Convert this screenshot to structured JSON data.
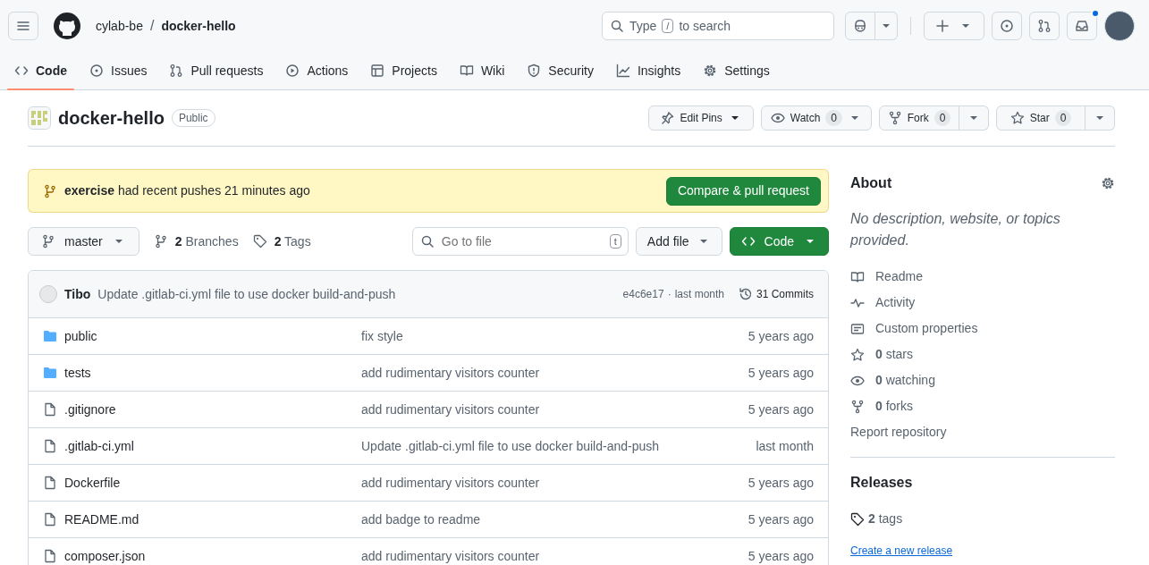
{
  "header": {
    "owner": "cylab-be",
    "separator": "/",
    "repo": "docker-hello",
    "search": {
      "prefix": "Type",
      "key": "/",
      "suffix": "to search"
    },
    "inbox_unread": true
  },
  "tabs": [
    {
      "label": "Code",
      "selected": true
    },
    {
      "label": "Issues",
      "selected": false
    },
    {
      "label": "Pull requests",
      "selected": false
    },
    {
      "label": "Actions",
      "selected": false
    },
    {
      "label": "Projects",
      "selected": false
    },
    {
      "label": "Wiki",
      "selected": false
    },
    {
      "label": "Security",
      "selected": false
    },
    {
      "label": "Insights",
      "selected": false
    },
    {
      "label": "Settings",
      "selected": false
    }
  ],
  "repo": {
    "name": "docker-hello",
    "visibility": "Public",
    "edit_pins": "Edit Pins",
    "watch": {
      "label": "Watch",
      "count": "0"
    },
    "fork": {
      "label": "Fork",
      "count": "0"
    },
    "star": {
      "label": "Star",
      "count": "0"
    }
  },
  "banner": {
    "text": "**exercise** had recent pushes 21 minutes ago",
    "button": "Compare & pull request"
  },
  "toolbar": {
    "branch": "master",
    "branches": "**2** Branches",
    "tags": "**2** Tags",
    "go_to_file": {
      "placeholder": "Go to file",
      "key": "t"
    },
    "add_file": "Add file",
    "code": "Code"
  },
  "commit": {
    "author": "Tibo",
    "message": "Update .gitlab-ci.yml file to use docker build-and-push",
    "sha": "e4c6e17",
    "dot": "·",
    "time": "last month",
    "commits": "31 Commits"
  },
  "files": [
    {
      "kind": "folder",
      "name": "public",
      "message": "fix style",
      "time": "5 years ago"
    },
    {
      "kind": "folder",
      "name": "tests",
      "message": "add rudimentary visitors counter",
      "time": "5 years ago"
    },
    {
      "kind": "file",
      "name": ".gitignore",
      "message": "add rudimentary visitors counter",
      "time": "5 years ago"
    },
    {
      "kind": "file",
      "name": ".gitlab-ci.yml",
      "message": "Update .gitlab-ci.yml file to use docker build-and-push",
      "time": "last month"
    },
    {
      "kind": "file",
      "name": "Dockerfile",
      "message": "add rudimentary visitors counter",
      "time": "5 years ago"
    },
    {
      "kind": "file",
      "name": "README.md",
      "message": "add badge to readme",
      "time": "5 years ago"
    },
    {
      "kind": "file",
      "name": "composer.json",
      "message": "add rudimentary visitors counter",
      "time": "5 years ago"
    }
  ],
  "about": {
    "title": "About",
    "description": "No description, website, or topics provided.",
    "items": [
      {
        "kind": "readme",
        "text": "Readme"
      },
      {
        "kind": "activity",
        "text": "Activity"
      },
      {
        "kind": "properties",
        "text": "Custom properties"
      },
      {
        "kind": "stars",
        "text": "**0** stars"
      },
      {
        "kind": "watching",
        "text": "**0** watching"
      },
      {
        "kind": "forks",
        "text": "**0** forks"
      }
    ],
    "report": "Report repository"
  },
  "releases": {
    "title": "Releases",
    "tags": "**2** tags",
    "create": "Create a new release"
  }
}
